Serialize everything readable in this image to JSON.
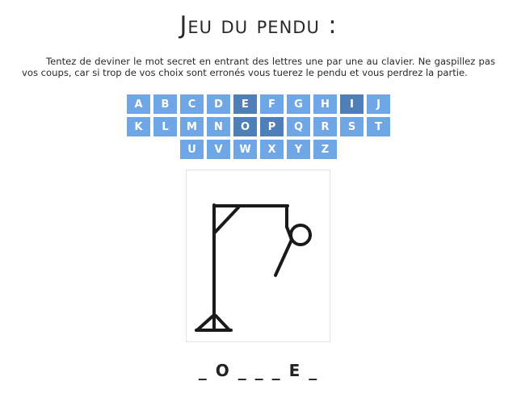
{
  "title": "Jeu du pendu :",
  "intro": "Tentez de deviner le mot secret en entrant des lettres une par une au clavier. Ne gaspillez pas vos coups, car si trop de vos choix sont erronés vous tuerez le pendu et vous perdrez la partie.",
  "keyboard": {
    "rows": [
      [
        "A",
        "B",
        "C",
        "D",
        "E",
        "F",
        "G",
        "H",
        "I",
        "J"
      ],
      [
        "K",
        "L",
        "M",
        "N",
        "O",
        "P",
        "Q",
        "R",
        "S",
        "T"
      ],
      [
        "U",
        "V",
        "W",
        "X",
        "Y",
        "Z"
      ]
    ],
    "used_letters": [
      "E",
      "I",
      "O",
      "P"
    ]
  },
  "colors": {
    "key": "#6fa6e6",
    "key_used": "#4f7fb9",
    "drawing": "#1a1a1a"
  },
  "word_display": "_ O _ _ _ E _",
  "hangman_stage": "gallows, rope, head"
}
